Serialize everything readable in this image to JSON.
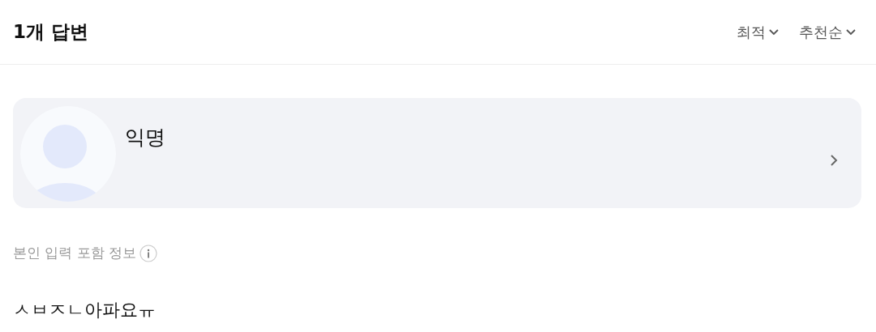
{
  "header": {
    "title": "1개 답변",
    "sort_menus": [
      {
        "label": "최적"
      },
      {
        "label": "추천순"
      }
    ]
  },
  "answer": {
    "author": {
      "name": "익명"
    },
    "info_label": "본인 입력 포함 정보",
    "body": "ㅅㅂㅈㄴ아파요ㅠ"
  }
}
